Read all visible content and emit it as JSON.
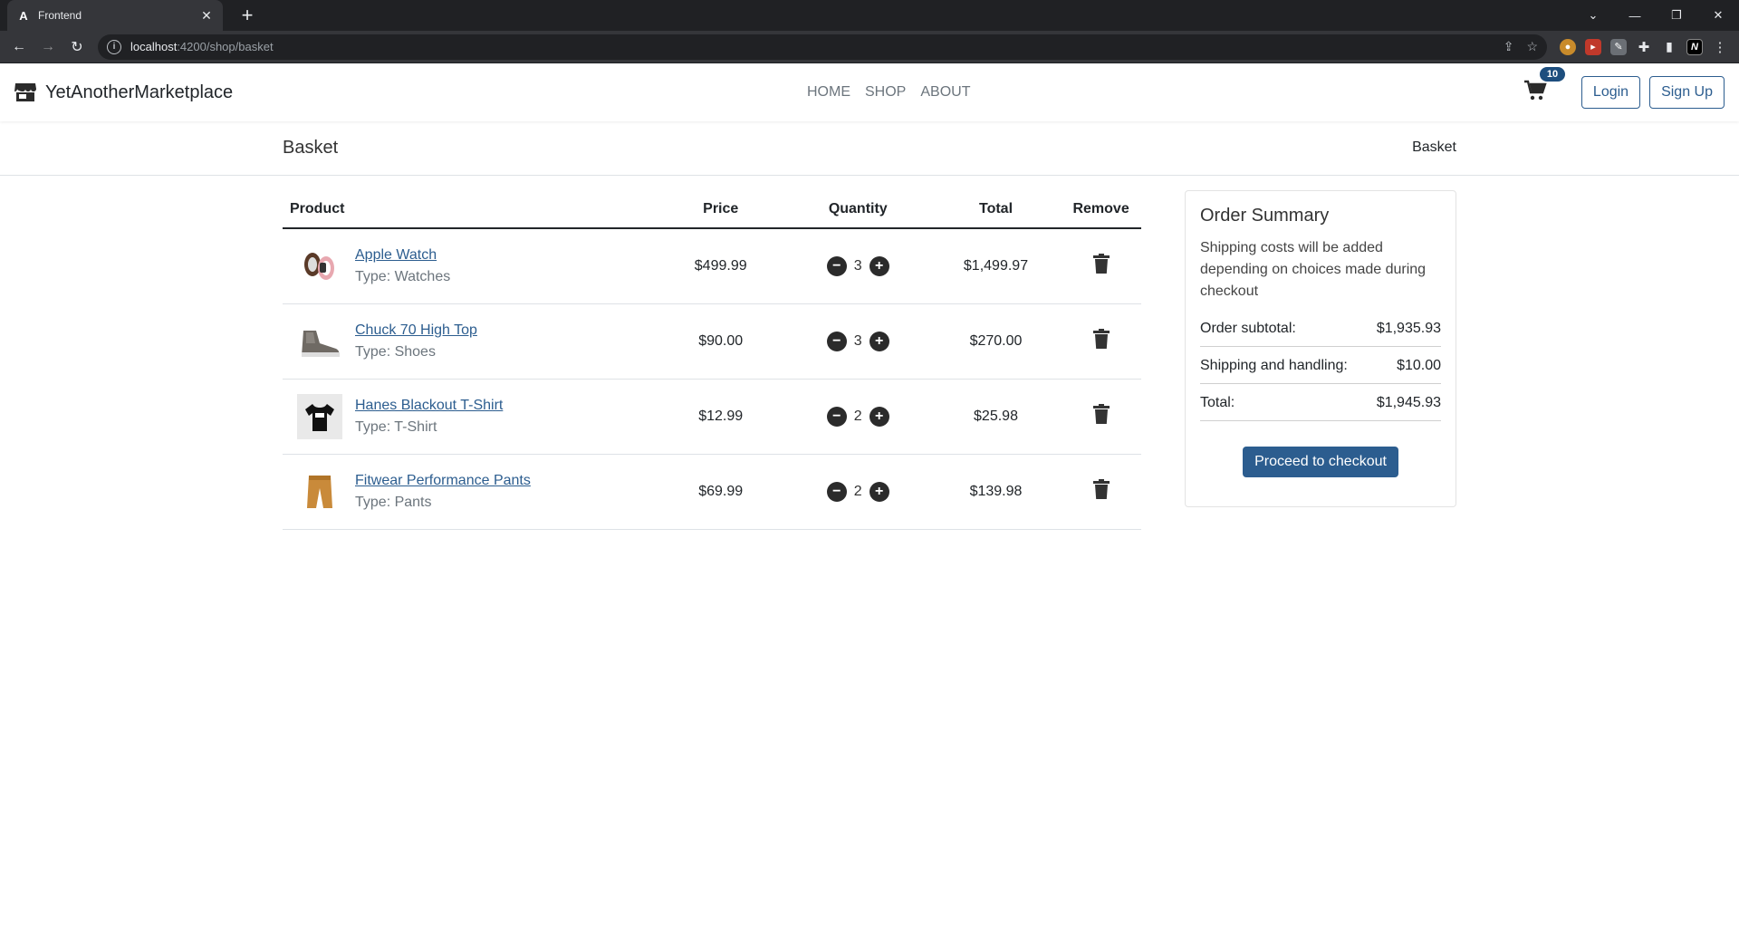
{
  "browser": {
    "tab_title": "Frontend",
    "url_host": "localhost",
    "url_path": ":4200/shop/basket"
  },
  "navbar": {
    "brand": "YetAnotherMarketplace",
    "links": [
      "HOME",
      "SHOP",
      "ABOUT"
    ],
    "cart_count": "10",
    "login_label": "Login",
    "signup_label": "Sign Up"
  },
  "header": {
    "title": "Basket",
    "breadcrumb": "Basket"
  },
  "table": {
    "headers": {
      "product": "Product",
      "price": "Price",
      "quantity": "Quantity",
      "total": "Total",
      "remove": "Remove"
    },
    "rows": [
      {
        "name": "Apple Watch",
        "type": "Type: Watches",
        "price": "$499.99",
        "qty": "3",
        "total": "$1,499.97",
        "image": "watch-image"
      },
      {
        "name": "Chuck 70 High Top",
        "type": "Type: Shoes",
        "price": "$90.00",
        "qty": "3",
        "total": "$270.00",
        "image": "shoe-image"
      },
      {
        "name": "Hanes Blackout T-Shirt",
        "type": "Type: T-Shirt",
        "price": "$12.99",
        "qty": "2",
        "total": "$25.98",
        "image": "tshirt-image"
      },
      {
        "name": "Fitwear Performance Pants",
        "type": "Type: Pants",
        "price": "$69.99",
        "qty": "2",
        "total": "$139.98",
        "image": "pants-image"
      }
    ]
  },
  "summary": {
    "title": "Order Summary",
    "note": "Shipping costs will be added depending on choices made during checkout",
    "subtotal_label": "Order subtotal:",
    "subtotal_value": "$1,935.93",
    "shipping_label": "Shipping and handling:",
    "shipping_value": "$10.00",
    "total_label": "Total:",
    "total_value": "$1,945.93",
    "checkout_label": "Proceed to checkout"
  },
  "colors": {
    "primary": "#2c5d8f",
    "badge": "#1d4e7e"
  }
}
